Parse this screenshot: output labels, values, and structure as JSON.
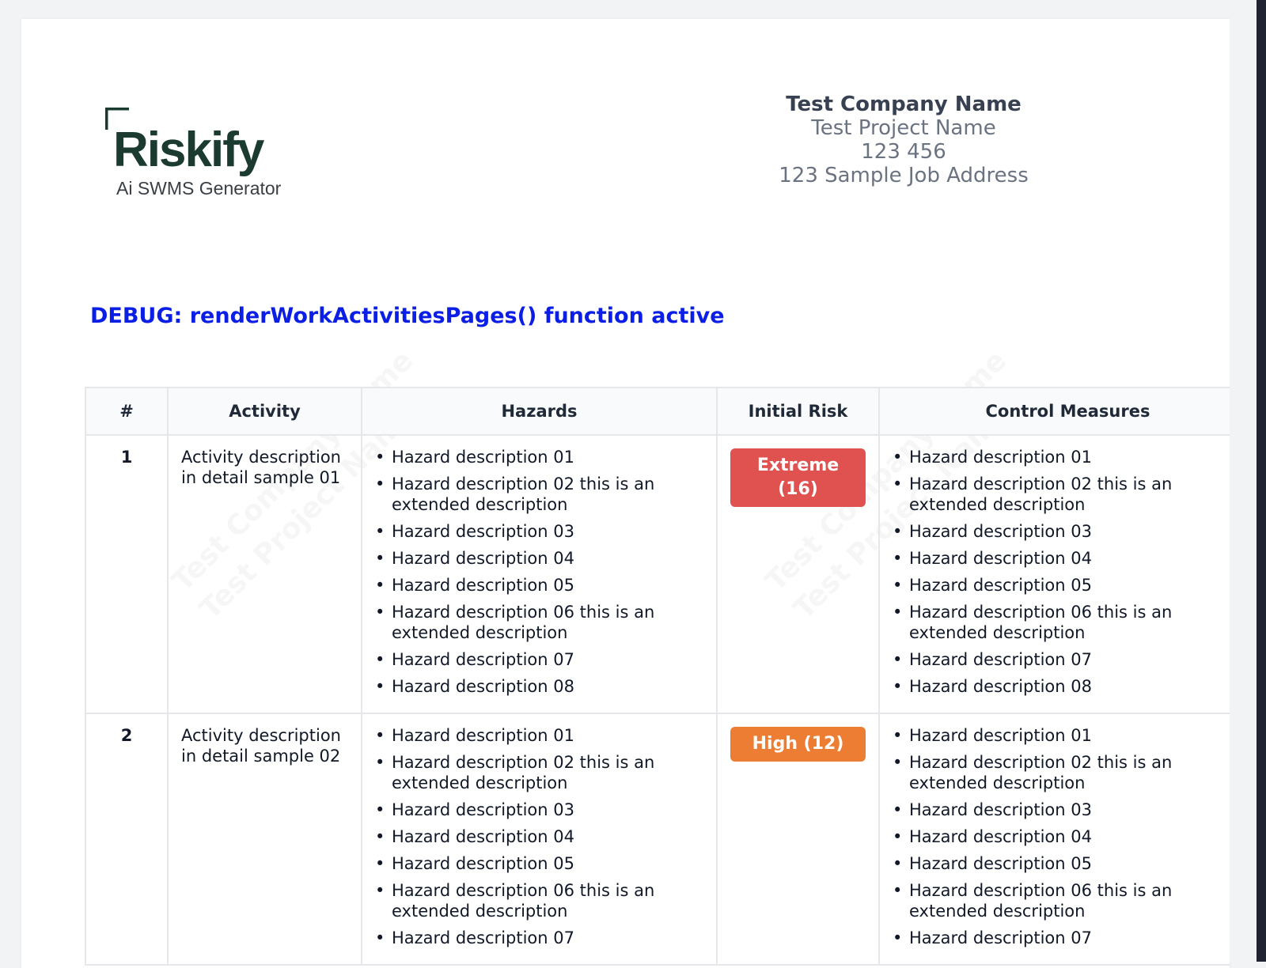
{
  "header": {
    "logo": {
      "wordmark": "Riskify",
      "tagline": "Ai SWMS Generator"
    },
    "company_name": "Test Company Name",
    "project_name": "Test Project Name",
    "project_number": "123 456",
    "job_address": "123 Sample Job Address"
  },
  "debug_text": "DEBUG: renderWorkActivitiesPages() function active",
  "table": {
    "headers": [
      "#",
      "Activity",
      "Hazards",
      "Initial Risk",
      "Control Measures"
    ],
    "rows": [
      {
        "num": "1",
        "activity": "Activity description in detail sample 01",
        "hazards": [
          "Hazard description 01",
          "Hazard description 02 this is an extended description",
          "Hazard description 03",
          "Hazard description 04",
          "Hazard description 05",
          "Hazard description 06 this is an extended description",
          "Hazard description 07",
          "Hazard description 08"
        ],
        "risk": {
          "label": "Extreme (16)",
          "level": "extreme",
          "color": "#e05250"
        },
        "controls": [
          "Hazard description 01",
          "Hazard description 02 this is an extended description",
          "Hazard description 03",
          "Hazard description 04",
          "Hazard description 05",
          "Hazard description 06 this is an extended description",
          "Hazard description 07",
          "Hazard description 08"
        ]
      },
      {
        "num": "2",
        "activity": "Activity description in detail sample 02",
        "hazards": [
          "Hazard description 01",
          "Hazard description 02 this is an extended description",
          "Hazard description 03",
          "Hazard description 04",
          "Hazard description 05",
          "Hazard description 06 this is an extended description",
          "Hazard description 07"
        ],
        "risk": {
          "label": "High (12)",
          "level": "high",
          "color": "#ec7d33"
        },
        "controls": [
          "Hazard description 01",
          "Hazard description 02 this is an extended description",
          "Hazard description 03",
          "Hazard description 04",
          "Hazard description 05",
          "Hazard description 06 this is an extended description",
          "Hazard description 07"
        ]
      }
    ]
  },
  "colors": {
    "logo_dark": "#1c3b30",
    "debug_blue": "#0a1ee6",
    "risk_extreme": "#e05250",
    "risk_high": "#ec7d33"
  }
}
